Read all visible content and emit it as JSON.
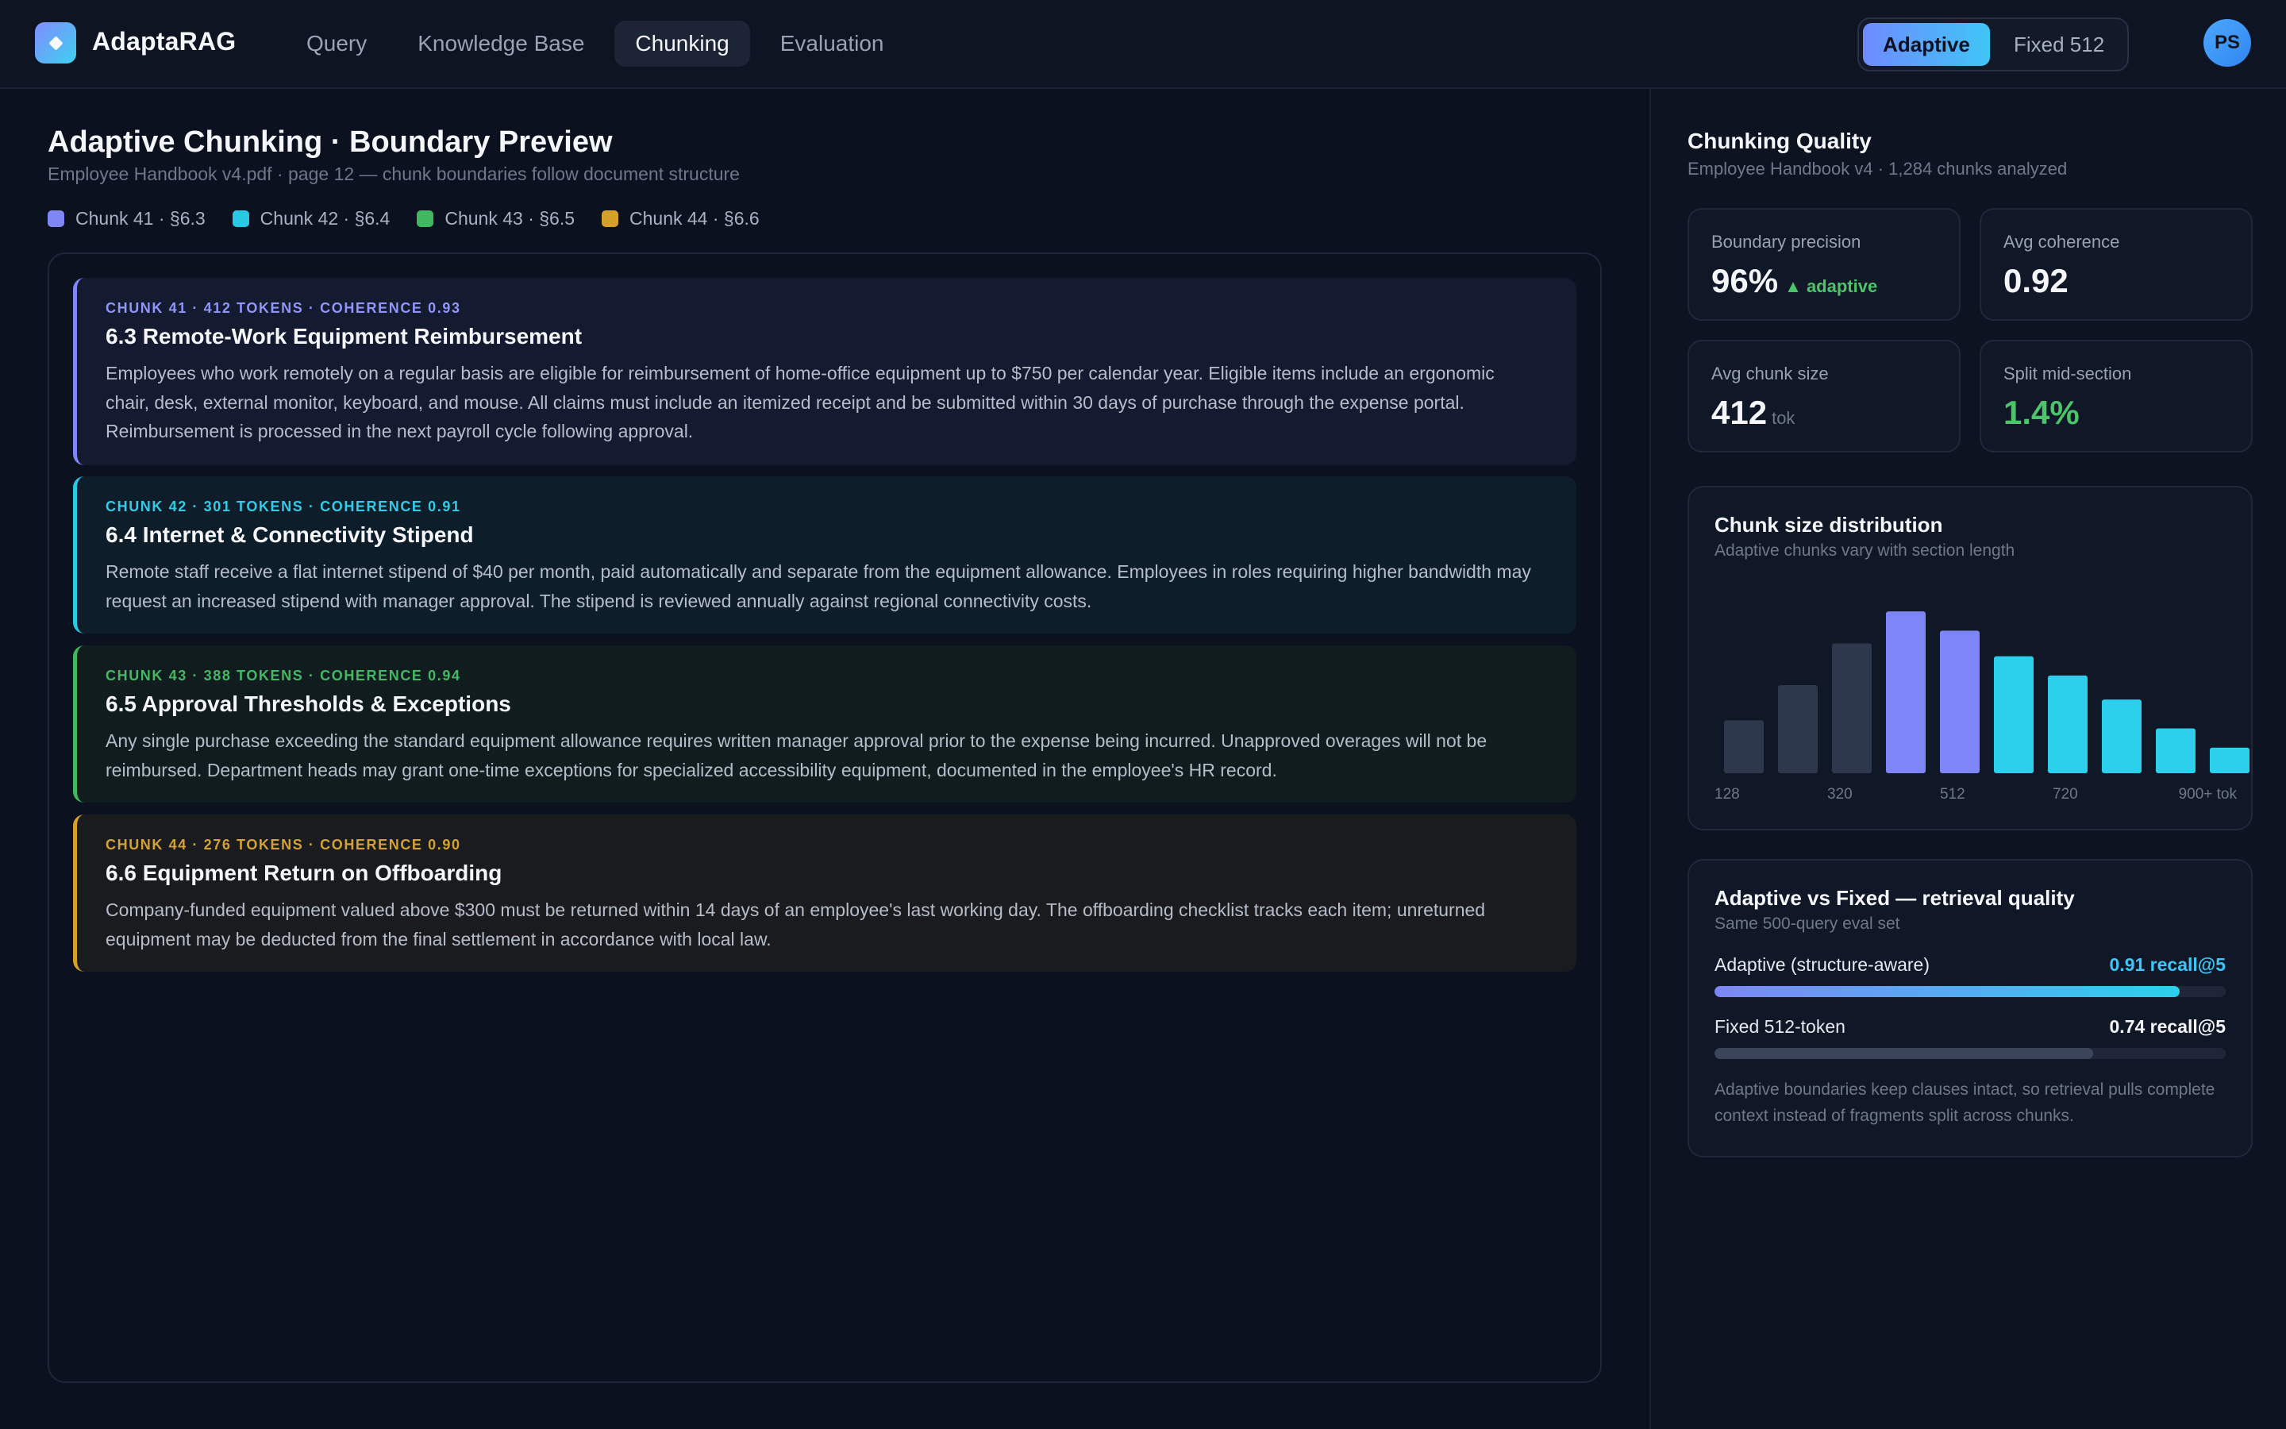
{
  "app": {
    "name": "AdaptaRAG",
    "nav_tabs": [
      "Query",
      "Knowledge Base",
      "Chunking",
      "Evaluation"
    ],
    "active_tab": "Chunking",
    "mode_options": [
      "Adaptive",
      "Fixed 512"
    ],
    "active_mode": "Adaptive",
    "user_initials": "PS"
  },
  "preview": {
    "title": "Adaptive Chunking · Boundary Preview",
    "subtitle": "Employee Handbook v4.pdf · page 12 — chunk boundaries follow document structure",
    "legend": [
      {
        "label": "Chunk 41 · §6.3",
        "color": "#7f86f5"
      },
      {
        "label": "Chunk 42 · §6.4",
        "color": "#29c9e6"
      },
      {
        "label": "Chunk 43 · §6.5",
        "color": "#3fb860"
      },
      {
        "label": "Chunk 44 · §6.6",
        "color": "#d6a12b"
      }
    ],
    "chunks": [
      {
        "meta": "CHUNK 41 · 412 TOKENS · COHERENCE 0.93",
        "title": "6.3 Remote-Work Equipment Reimbursement",
        "body": "Employees who work remotely on a regular basis are eligible for reimbursement of home-office equipment up to $750 per calendar year. Eligible items include an ergonomic chair, desk, external monitor, keyboard, and mouse. All claims must include an itemized receipt and be submitted within 30 days of purchase through the expense portal. Reimbursement is processed in the next payroll cycle following approval.",
        "accent": "#7f86f5",
        "meta_color": "#8f96f8",
        "bg": "#141a2f"
      },
      {
        "meta": "CHUNK 42 · 301 TOKENS · COHERENCE 0.91",
        "title": "6.4 Internet & Connectivity Stipend",
        "body": "Remote staff receive a flat internet stipend of $40 per month, paid automatically and separate from the equipment allowance. Employees in roles requiring higher bandwidth may request an increased stipend with manager approval. The stipend is reviewed annually against regional connectivity costs.",
        "accent": "#29c9e6",
        "meta_color": "#33cbe6",
        "bg": "#0e1d2a"
      },
      {
        "meta": "CHUNK 43 · 388 TOKENS · COHERENCE 0.94",
        "title": "6.5 Approval Thresholds & Exceptions",
        "body": "Any single purchase exceeding the standard equipment allowance requires written manager approval prior to the expense being incurred. Unapproved overages will not be reimbursed. Department heads may grant one-time exceptions for specialized accessibility equipment, documented in the employee's HR record.",
        "accent": "#3fb860",
        "meta_color": "#45b865",
        "bg": "#111c1e"
      },
      {
        "meta": "CHUNK 44 · 276 TOKENS · COHERENCE 0.90",
        "title": "6.6 Equipment Return on Offboarding",
        "body": "Company-funded equipment valued above $300 must be returned within 14 days of an employee's last working day. The offboarding checklist tracks each item; unreturned equipment may be deducted from the final settlement in accordance with local law.",
        "accent": "#d6a12b",
        "meta_color": "#d4a233",
        "bg": "#191b1e"
      }
    ]
  },
  "quality": {
    "title": "Chunking Quality",
    "subtitle": "Employee Handbook v4 · 1,284 chunks analyzed",
    "stats": [
      {
        "label": "Boundary precision",
        "value": "96%",
        "delta": "▲ adaptive",
        "unit": "",
        "value_green": false
      },
      {
        "label": "Avg coherence",
        "value": "0.92",
        "delta": "",
        "unit": "",
        "value_green": false
      },
      {
        "label": "Avg chunk size",
        "value": "412",
        "delta": "",
        "unit": "tok",
        "value_green": false
      },
      {
        "label": "Split mid-section",
        "value": "1.4%",
        "delta": "",
        "unit": "",
        "value_green": true
      }
    ]
  },
  "chart_data": {
    "type": "bar",
    "title": "Chunk size distribution",
    "subtitle": "Adaptive chunks vary with section length",
    "tick_labels": [
      "128",
      "320",
      "512",
      "720",
      "900+ tok"
    ],
    "values": [
      33,
      55,
      81,
      101,
      89,
      73,
      61,
      46,
      28,
      16
    ],
    "bar_colors": [
      "#2d384d",
      "#2d384d",
      "#2d384d",
      "#7e86f7",
      "#7e86f7",
      "#2cd0ec",
      "#2cd0ec",
      "#2cd0ec",
      "#2cd0ec",
      "#2cd0ec"
    ],
    "ylim": [
      0,
      110
    ],
    "grid": false,
    "legend": "none"
  },
  "comparison": {
    "title": "Adaptive vs Fixed — retrieval quality",
    "subtitle": "Same 500-query eval set",
    "rows": [
      {
        "label": "Adaptive (structure-aware)",
        "value_text": "0.91 recall@5",
        "value": 0.91,
        "value_color": "#3fc6f6",
        "gradient": true
      },
      {
        "label": "Fixed 512-token",
        "value_text": "0.74 recall@5",
        "value": 0.74,
        "value_color": "#f4f6fa",
        "gradient": false
      }
    ],
    "note": "Adaptive boundaries keep clauses intact, so retrieval pulls complete context instead of fragments split across chunks."
  }
}
